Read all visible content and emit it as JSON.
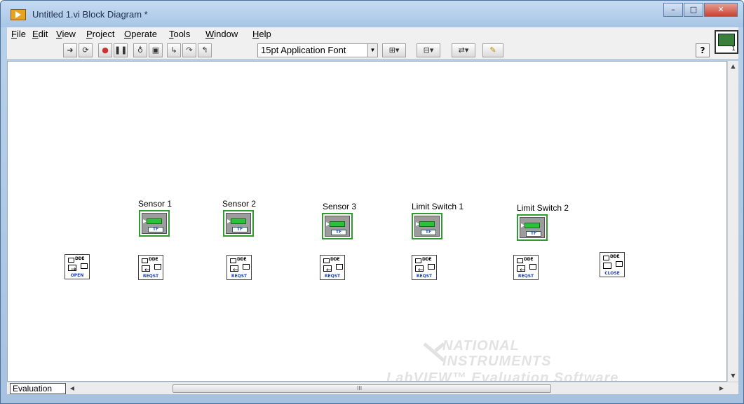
{
  "window": {
    "title": "Untitled 1.vi Block Diagram *",
    "controls": {
      "minimize": "–",
      "maximize": "□",
      "close": "✕"
    }
  },
  "menu": [
    {
      "label": "File",
      "accel": "F",
      "rest": "ile"
    },
    {
      "label": "Edit",
      "accel": "E",
      "rest": "dit"
    },
    {
      "label": "View",
      "accel": "V",
      "rest": "iew"
    },
    {
      "label": "Project",
      "accel": "P",
      "rest": "roject"
    },
    {
      "label": "Operate",
      "accel": "O",
      "rest": "perate"
    },
    {
      "label": "Tools",
      "accel": "T",
      "rest": "ools"
    },
    {
      "label": "Window",
      "accel": "W",
      "rest": "indow"
    },
    {
      "label": "Help",
      "accel": "H",
      "rest": "elp"
    }
  ],
  "toolbar": {
    "font_select": "15pt Application Font",
    "buttons": [
      "run-arrow-icon",
      "run-continuous-icon",
      "abort-icon",
      "pause-icon",
      "highlight-execution-icon",
      "retain-wire-values-icon",
      "step-into-icon",
      "step-over-icon",
      "step-out-icon",
      "align-objects-icon",
      "distribute-objects-icon",
      "reorder-icon",
      "cleanup-diagram-icon"
    ],
    "help": "?"
  },
  "vi_icon": {
    "number": "1"
  },
  "indicators": [
    {
      "label": "Sensor 1",
      "face": "TF"
    },
    {
      "label": "Sensor 2",
      "face": "TF"
    },
    {
      "label": "Sensor  3",
      "face": "TF"
    },
    {
      "label": "Limit Switch 1",
      "face": "TF"
    },
    {
      "label": "Limit Switch 2",
      "face": "TF"
    }
  ],
  "dde_nodes": [
    {
      "top": "DDE",
      "caption": "OPEN"
    },
    {
      "top": "DDE",
      "caption": "REQST"
    },
    {
      "top": "DDE",
      "caption": "REQST"
    },
    {
      "top": "DDE",
      "caption": "REQST"
    },
    {
      "top": "DDE",
      "caption": "REQST"
    },
    {
      "top": "DDE",
      "caption": "REQST"
    },
    {
      "top": "DDE",
      "caption": "CLOSE"
    }
  ],
  "watermark": {
    "line1": "NATIONAL",
    "line2": "INSTRUMENTS",
    "line3": "LabVIEW™ Evaluation Software"
  },
  "bottom": {
    "tab": "Evaluation",
    "grip": "III"
  }
}
